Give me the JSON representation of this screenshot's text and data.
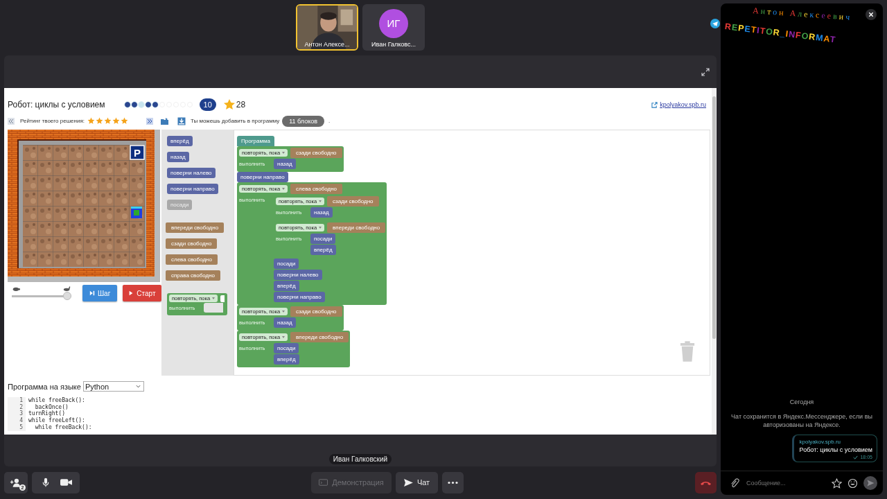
{
  "participants": [
    {
      "name": "Антон Алексе...",
      "kind": "video",
      "selected": true
    },
    {
      "name": "Иван Галковс...",
      "kind": "avatar",
      "initials": "ИГ",
      "color": "#b04fe0",
      "selected": false
    }
  ],
  "speaker_label": "Иван Галковский",
  "page": {
    "title": "Робот: циклы с условием",
    "levels": [
      {
        "done": true,
        "visited": true
      },
      {
        "done": true,
        "visited": true
      },
      {
        "done": false,
        "visited": true
      },
      {
        "done": true,
        "visited": true
      },
      {
        "done": true,
        "visited": true
      },
      {
        "done": false,
        "visited": false
      },
      {
        "done": false,
        "visited": false
      },
      {
        "done": false,
        "visited": false
      },
      {
        "done": false,
        "visited": false
      },
      {
        "done": false,
        "visited": false
      }
    ],
    "level_number": "10",
    "score": "28",
    "site_link": "kpolyakov.spb.ru",
    "rating_label": "Рейтинг твоего решения:",
    "stars": 5,
    "add_hint": "Ты можешь добавить в программу",
    "blocks_left": "11 блоков",
    "hint_end": ".",
    "board": {
      "sign": "P"
    },
    "speed": {
      "level": 0.93
    },
    "step_button": "Шаг",
    "start_button": "Старт",
    "toolbox": [
      {
        "kind": "command",
        "label": "вперёд",
        "disabled": false
      },
      {
        "kind": "command",
        "label": "назад",
        "disabled": false
      },
      {
        "kind": "command",
        "label": "поверни налево",
        "disabled": false
      },
      {
        "kind": "command",
        "label": "поверни направо",
        "disabled": false
      },
      {
        "kind": "command",
        "label": "посади",
        "disabled": true
      },
      {
        "kind": "condition",
        "label": "впереди свободно",
        "disabled": false
      },
      {
        "kind": "condition",
        "label": "сзади свободно",
        "disabled": false
      },
      {
        "kind": "condition",
        "label": "слева свободно",
        "disabled": false
      },
      {
        "kind": "condition",
        "label": "справа свободно",
        "disabled": false
      },
      {
        "kind": "loop",
        "head": "повторять, пока",
        "do_label": "выполнить",
        "disabled": false
      }
    ],
    "program": {
      "header": "Программа",
      "blocks": [
        {
          "kind": "loop",
          "head": "повторять, пока",
          "condition": "сзади свободно",
          "do_label": "выполнить",
          "children": [
            {
              "kind": "command",
              "label": "назад"
            }
          ]
        },
        {
          "kind": "command",
          "label": "поверни направо"
        },
        {
          "kind": "loop",
          "head": "повторять, пока",
          "condition": "слева свободно",
          "do_label": "выполнить",
          "children": [
            {
              "kind": "loop",
              "head": "повторять, пока",
              "condition": "сзади свободно",
              "do_label": "выполнить",
              "children": [
                {
                  "kind": "command",
                  "label": "назад"
                }
              ]
            },
            {
              "kind": "loop",
              "head": "повторять, пока",
              "condition": "впереди свободно",
              "do_label": "выполнить",
              "children": [
                {
                  "kind": "command",
                  "label": "посади"
                },
                {
                  "kind": "command",
                  "label": "вперёд"
                }
              ]
            },
            {
              "kind": "command",
              "label": "посади"
            },
            {
              "kind": "command",
              "label": "поверни налево"
            },
            {
              "kind": "command",
              "label": "вперёд"
            },
            {
              "kind": "command",
              "label": "поверни направо"
            }
          ]
        },
        {
          "kind": "loop",
          "head": "повторять, пока",
          "condition": "сзади свободно",
          "do_label": "выполнить",
          "children": [
            {
              "kind": "command",
              "label": "назад"
            }
          ]
        },
        {
          "kind": "loop",
          "head": "повторять, пока",
          "condition": "впереди свободно",
          "do_label": "выполнить",
          "children": [
            {
              "kind": "command",
              "label": "посади"
            },
            {
              "kind": "command",
              "label": "вперёд"
            }
          ]
        }
      ]
    },
    "language_label": "Программа на языке",
    "language": "Python",
    "code": [
      {
        "n": "1",
        "text": "while freeBack():"
      },
      {
        "n": "2",
        "text": "  backOnce()"
      },
      {
        "n": "3",
        "text": "turnRight()"
      },
      {
        "n": "4",
        "text": "while freeLeft():"
      },
      {
        "n": "5",
        "text": "  while freeBack():"
      }
    ]
  },
  "toolbar": {
    "add_badge": "2",
    "screen_share": {
      "label": "Демонстрация",
      "disabled": true
    },
    "chat": "Чат"
  },
  "chat": {
    "banner_name": "Антон Алексеевич",
    "banner_brand": "REPETITOR_INFORMAT",
    "day": "Сегодня",
    "notice": "Чат сохранится в Яндекс.Мессенджере, если вы авторизованы на Яндексе.",
    "messages": [
      {
        "link": "kpolyakov.spb.ru",
        "text": "Робот: циклы с условием",
        "time": "18:05"
      }
    ],
    "placeholder": "Сообщение..."
  }
}
